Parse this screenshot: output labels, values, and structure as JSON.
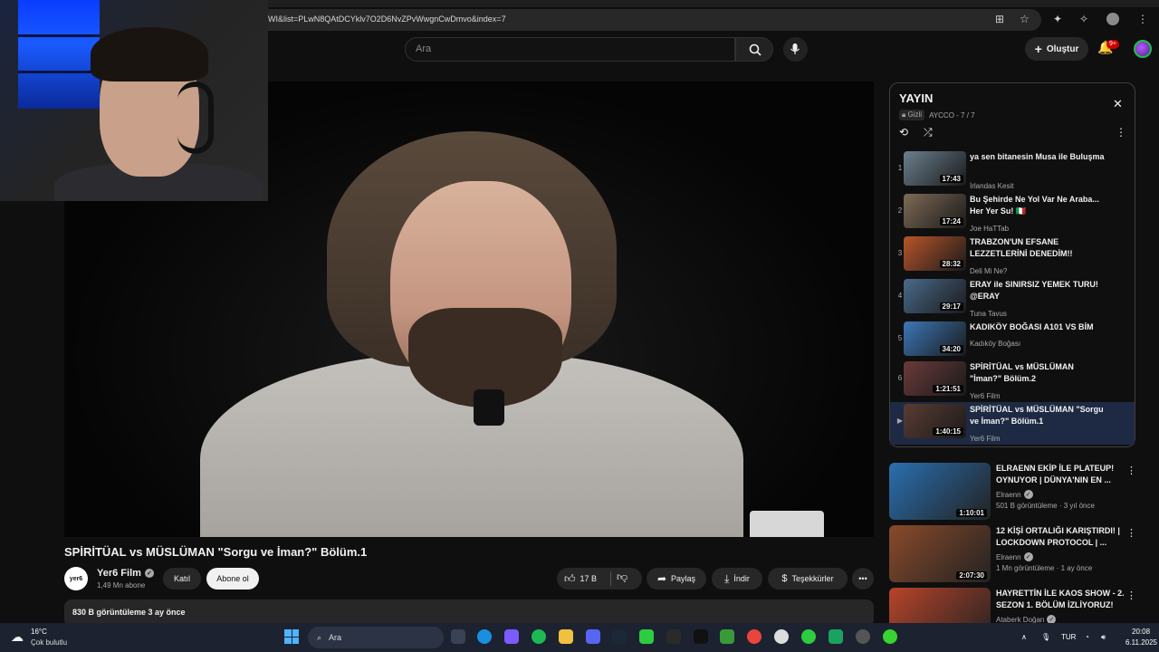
{
  "browser": {
    "url": "WI&list=PLwN8QAtDCYklv7O2D6NvZPvWwgnCwDmvo&index=7"
  },
  "header": {
    "search_placeholder": "Ara",
    "create_label": "Oluştur",
    "notif_badge": "9+"
  },
  "video": {
    "title": "SPİRİTÜAL vs MÜSLÜMAN \"Sorgu ve İman?\" Bölüm.1",
    "channel_logo": "yer6",
    "channel": "Yer6 Film",
    "subscribers": "1,49 Mn abone",
    "join_label": "Katıl",
    "subscribe_label": "Abone ol",
    "likes": "17 B",
    "share_label": "Paylaş",
    "download_label": "İndir",
    "thanks_label": "Teşekkürler",
    "views_date": "830 B görüntüleme  3 ay önce"
  },
  "playlist": {
    "title": "YAYIN",
    "privacy": "Gizli",
    "owner_pos": "AYCCO - 7 / 7",
    "items": [
      {
        "idx": "1",
        "title": "ya sen bitanesin Musa ile Buluşma",
        "channel": "İrlandas Kesit",
        "duration": "17:43",
        "color": "#6b7f8e"
      },
      {
        "idx": "2",
        "title": "Bu Şehirde Ne Yol Var Ne Araba... Her Yer Su! 🇮🇹",
        "channel": "Joe HaTTab",
        "duration": "17:24",
        "color": "#7d6a55"
      },
      {
        "idx": "3",
        "title": "TRABZON'UN EFSANE LEZZETLERİNİ DENEDİM!!",
        "channel": "Deli Mi Ne?",
        "duration": "28:32",
        "color": "#b8552a"
      },
      {
        "idx": "4",
        "title": "ERAY ile SINIRSIZ YEMEK TURU! @ERAY",
        "channel": "Tuna Tavus",
        "duration": "29:17",
        "color": "#4a6a8a"
      },
      {
        "idx": "5",
        "title": "KADIKÖY BOĞASI A101 VS BİM",
        "channel": "Kadıköy Boğası",
        "duration": "34:20",
        "color": "#3c77b8"
      },
      {
        "idx": "6",
        "title": "SPİRİTÜAL vs MÜSLÜMAN \"İman?\" Bölüm.2",
        "channel": "Yer6 Film",
        "duration": "1:21:51",
        "color": "#6b3a3a"
      },
      {
        "idx": "▶",
        "title": "SPİRİTÜAL vs MÜSLÜMAN \"Sorgu ve İman?\" Bölüm.1",
        "channel": "Yer6 Film",
        "duration": "1:40:15",
        "color": "#5a3c34"
      }
    ]
  },
  "recommendations": [
    {
      "title": "ELRAENN EKİP İLE PLATEUP! OYNUYOR | DÜNYA'NIN EN ...",
      "channel": "Elraenn",
      "meta": "501 B görüntüleme · 3 yıl önce",
      "duration": "1:10:01",
      "color": "#2a6fb0"
    },
    {
      "title": "12 KİŞİ ORTALIĞI KARIŞTIRDI! | LOCKDOWN PROTOCOL | ...",
      "channel": "Elraenn",
      "meta": "1 Mn görüntüleme · 1 ay önce",
      "duration": "2:07:30",
      "color": "#8a4a2a"
    },
    {
      "title": "HAYRETTİN İLE KAOS SHOW - 2. SEZON 1. BÖLÜM İZLİYORUZ!",
      "channel": "Ataberk Doğan",
      "meta": "",
      "duration": "",
      "color": "#b8442a"
    }
  ],
  "taskbar": {
    "temp": "16°C",
    "weather": "Çok bulutlu",
    "search": "Ara",
    "lang": "TUR",
    "time": "20:08",
    "date": "6.11.2025"
  },
  "colors": {
    "bg": "#0f0f0f",
    "active_row": "#1e2a44",
    "badge": "#cc0000"
  }
}
